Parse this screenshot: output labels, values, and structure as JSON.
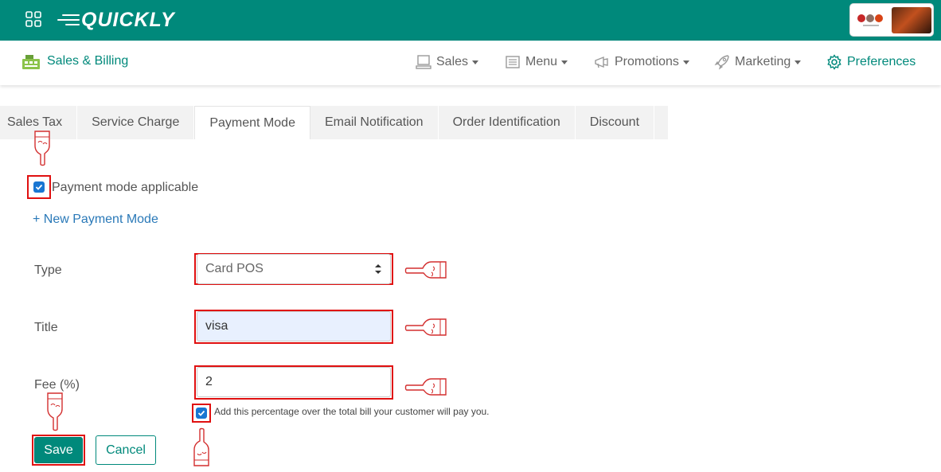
{
  "app": {
    "logo_text": "QUICKLY",
    "colors": {
      "brand": "#00897b",
      "highlight": "#e01010",
      "checkbox": "#1976d2",
      "link": "#2a79b8"
    }
  },
  "module": {
    "title": "Sales & Billing",
    "icon": "cash-register-icon"
  },
  "nav": {
    "items": [
      {
        "label": "Sales",
        "icon": "pos-terminal-icon",
        "dropdown": true
      },
      {
        "label": "Menu",
        "icon": "menu-card-icon",
        "dropdown": true
      },
      {
        "label": "Promotions",
        "icon": "megaphone-icon",
        "dropdown": true
      },
      {
        "label": "Marketing",
        "icon": "rocket-icon",
        "dropdown": true
      },
      {
        "label": "Preferences",
        "icon": "gear-icon",
        "dropdown": false,
        "active": true
      }
    ]
  },
  "tabs": [
    {
      "label": "Sales Tax"
    },
    {
      "label": "Service Charge"
    },
    {
      "label": "Payment Mode",
      "active": true
    },
    {
      "label": "Email Notification"
    },
    {
      "label": "Order Identification"
    },
    {
      "label": "Discount"
    }
  ],
  "form": {
    "applicable_label": "Payment mode applicable",
    "applicable_checked": true,
    "new_mode_link": "+ New Payment Mode",
    "type_label": "Type",
    "type_value": "Card POS",
    "title_label": "Title",
    "title_value": "visa",
    "fee_label": "Fee (%)",
    "fee_value": "2",
    "fee_help": "Add this percentage over the total bill your customer will pay you.",
    "fee_help_checked": true,
    "save_label": "Save",
    "cancel_label": "Cancel"
  }
}
